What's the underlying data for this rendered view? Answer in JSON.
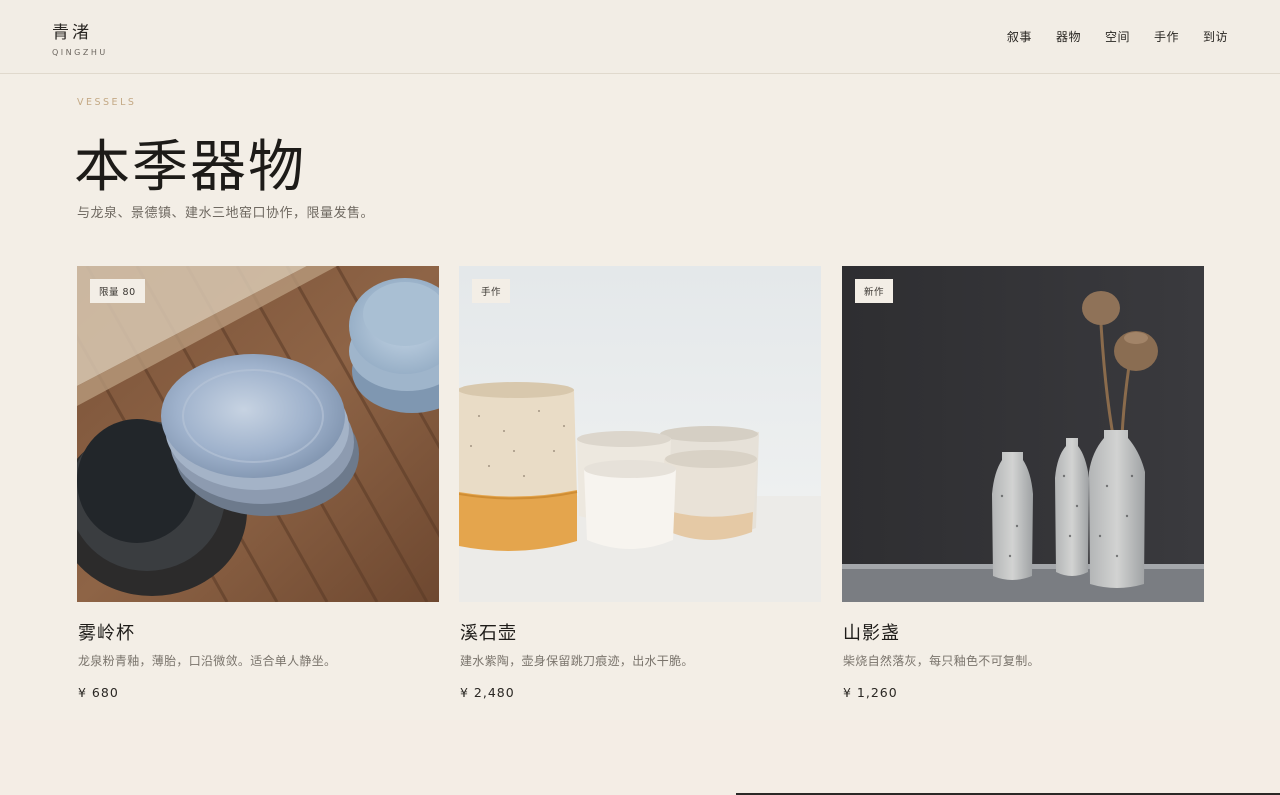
{
  "brand": {
    "name_cn": "青渚",
    "name_en": "QINGZHU"
  },
  "nav": [
    {
      "label": "叙事"
    },
    {
      "label": "器物"
    },
    {
      "label": "空间"
    },
    {
      "label": "手作"
    },
    {
      "label": "到访"
    }
  ],
  "hero": {
    "eyebrow": "VESSELS",
    "title": "本季器物",
    "subtitle": "与龙泉、景德镇、建水三地窑口协作，限量发售。"
  },
  "products": [
    {
      "badge": "限量 80",
      "name": "雾岭杯",
      "desc": "龙泉粉青釉，薄胎，口沿微敛。适合单人静坐。",
      "price": "¥ 680",
      "image": "blue-glazed-plates-on-wood"
    },
    {
      "badge": "手作",
      "name": "溪石壶",
      "desc": "建水紫陶，壶身保留跳刀痕迹，出水干脆。",
      "price": "¥ 2,480",
      "image": "speckled-cream-cups"
    },
    {
      "badge": "新作",
      "name": "山影盏",
      "desc": "柴烧自然落灰，每只釉色不可复制。",
      "price": "¥ 1,260",
      "image": "grey-bottle-vases-dark"
    }
  ],
  "colors": {
    "background": "#f3eee6",
    "accent": "#c4a985",
    "text": "#1f1d1a",
    "muted": "#7a746c"
  }
}
